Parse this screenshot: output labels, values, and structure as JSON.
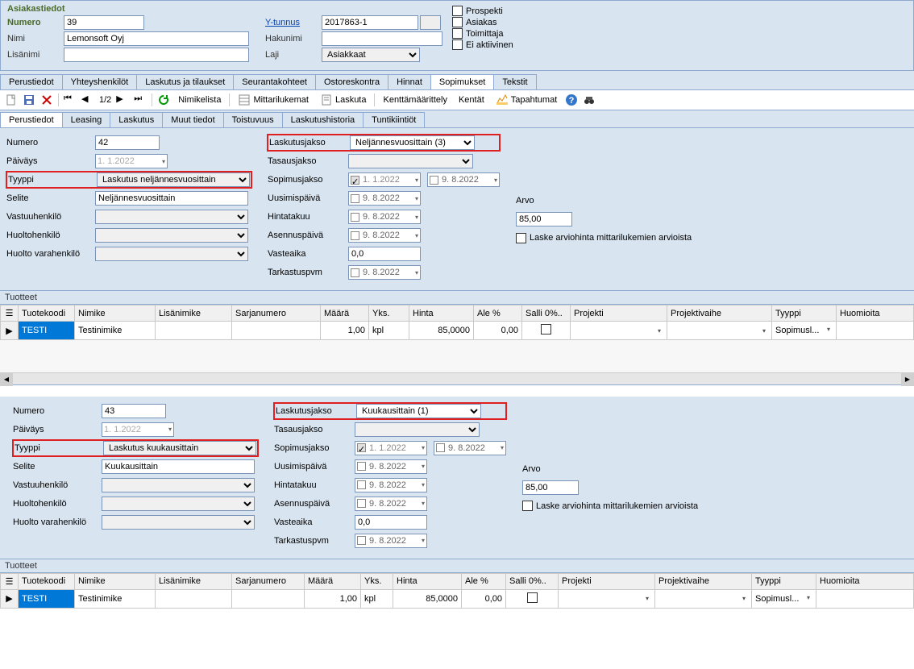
{
  "asiakastiedot": {
    "title": "Asiakastiedot",
    "numero_label": "Numero",
    "numero": "39",
    "nimi_label": "Nimi",
    "nimi": "Lemonsoft Oyj",
    "lisanimi_label": "Lisänimi",
    "lisanimi": "",
    "ytunnus_label": "Y-tunnus",
    "ytunnus": "2017863-1",
    "hakunimi_label": "Hakunimi",
    "hakunimi": "",
    "laji_label": "Laji",
    "laji": "Asiakkaat",
    "chk_prospekti": "Prospekti",
    "chk_asiakas": "Asiakas",
    "chk_toimittaja": "Toimittaja",
    "chk_eiaktiivinen": "Ei aktiivinen"
  },
  "tabs": {
    "main": [
      "Perustiedot",
      "Yhteyshenkilöt",
      "Laskutus ja tilaukset",
      "Seurantakohteet",
      "Ostoreskontra",
      "Hinnat",
      "Sopimukset",
      "Tekstit"
    ],
    "main_active": 6,
    "sub": [
      "Perustiedot",
      "Leasing",
      "Laskutus",
      "Muut tiedot",
      "Toistuvuus",
      "Laskutushistoria",
      "Tuntikiintiöt"
    ],
    "sub_active": 0
  },
  "toolbar": {
    "nav_page": "1/2",
    "nimikelista": "Nimikelista",
    "mittarilukemat": "Mittarilukemat",
    "laskuta": "Laskuta",
    "kenttamaarittely": "Kenttämäärittely",
    "kentat": "Kentät",
    "tapahtumat": "Tapahtumat"
  },
  "form1": {
    "numero_lbl": "Numero",
    "numero": "42",
    "paivays_lbl": "Päiväys",
    "paivays": "1.  1.2022",
    "tyyppi_lbl": "Tyyppi",
    "tyyppi": "Laskutus neljännesvuosittain",
    "selite_lbl": "Selite",
    "selite": "Neljännesvuosittain",
    "vastuuhenkilo_lbl": "Vastuuhenkilö",
    "huoltohenkilo_lbl": "Huoltohenkilö",
    "huoltovara_lbl": "Huolto varahenkilö",
    "laskutusjakso_lbl": "Laskutusjakso",
    "laskutusjakso": "Neljännesvuosittain (3)",
    "tasausjakso_lbl": "Tasausjakso",
    "sopimusjakso_lbl": "Sopimusjakso",
    "sopimusjakso_from": "1.  1.2022",
    "sopimusjakso_to": "9.  8.2022",
    "uusimispaiva_lbl": "Uusimispäivä",
    "uusimispaiva": "9.  8.2022",
    "hintatakuu_lbl": "Hintatakuu",
    "hintatakuu": "9.  8.2022",
    "asennuspaiva_lbl": "Asennuspäivä",
    "asennuspaiva": "9.  8.2022",
    "vasteaika_lbl": "Vasteaika",
    "vasteaika": "0,0",
    "tarkastuspvm_lbl": "Tarkastuspvm",
    "tarkastuspvm": "9.  8.2022",
    "arvo_lbl": "Arvo",
    "arvo": "85,00",
    "laske_lbl": "Laske arviohinta mittarilukemien arvioista"
  },
  "form2": {
    "numero": "43",
    "paivays": "1.  1.2022",
    "tyyppi": "Laskutus kuukausittain",
    "selite": "Kuukausittain",
    "laskutusjakso": "Kuukausittain (1)",
    "sopimusjakso_from": "1.  1.2022",
    "sopimusjakso_to": "9.  8.2022",
    "uusimispaiva": "9.  8.2022",
    "hintatakuu": "9.  8.2022",
    "asennuspaiva": "9.  8.2022",
    "vasteaika": "0,0",
    "tarkastuspvm": "9.  8.2022",
    "arvo": "85,00"
  },
  "table": {
    "title": "Tuotteet",
    "headers": [
      "Tuotekoodi",
      "Nimike",
      "Lisänimike",
      "Sarjanumero",
      "Määrä",
      "Yks.",
      "Hinta",
      "Ale %",
      "Salli 0%..",
      "Projekti",
      "Projektivaihe",
      "Tyyppi",
      "Huomioita"
    ],
    "row1": {
      "tuotekoodi": "TESTI",
      "nimike": "Testinimike",
      "lisanimike": "",
      "sarjanumero": "",
      "maara": "1,00",
      "yks": "kpl",
      "hinta": "85,0000",
      "ale": "0,00",
      "projekti": "",
      "projektivaihe": "",
      "tyyppi": "Sopimusl..."
    }
  }
}
